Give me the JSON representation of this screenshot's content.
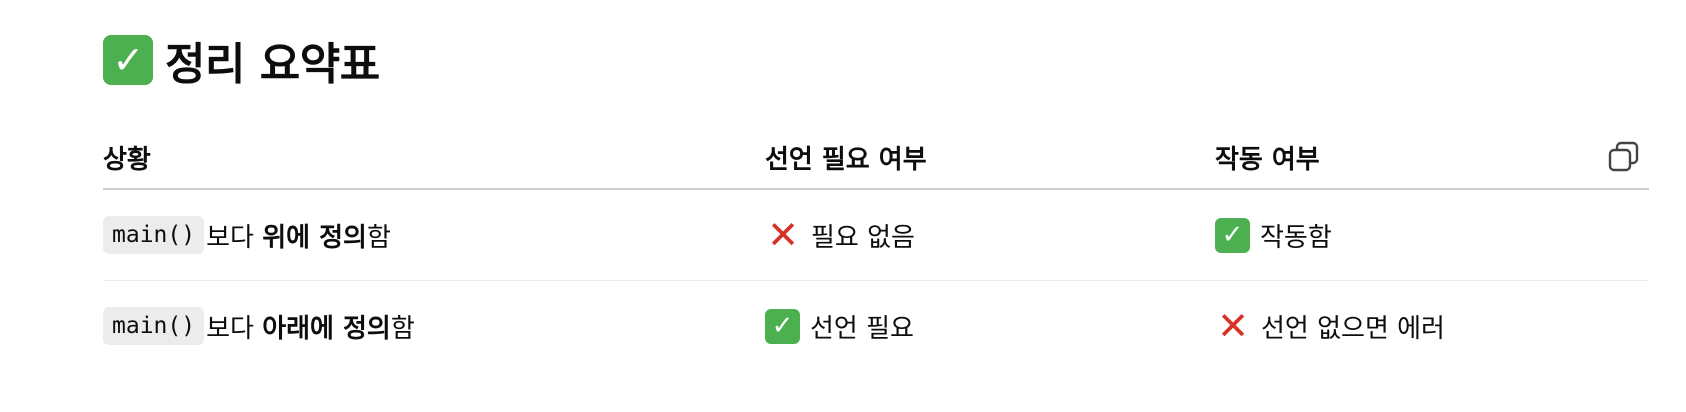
{
  "heading": {
    "icon": "check-mark-icon",
    "title": "정리 요약표"
  },
  "table": {
    "headers": [
      "상황",
      "선언 필요 여부",
      "작동 여부"
    ],
    "copy_icon": "copy-icon",
    "rows": [
      {
        "situation": {
          "code": "main()",
          "prefix": "보다 ",
          "bold": "위에 정의",
          "suffix": "함"
        },
        "declaration": {
          "icon": "cross-icon",
          "text": "필요 없음"
        },
        "works": {
          "icon": "check-mark-icon",
          "text": "작동함"
        }
      },
      {
        "situation": {
          "code": "main()",
          "prefix": "보다 ",
          "bold": "아래에 정의",
          "suffix": "함"
        },
        "declaration": {
          "icon": "check-mark-icon",
          "text": "선언 필요"
        },
        "works": {
          "icon": "cross-icon",
          "text": "선언 없으면 에러"
        }
      }
    ]
  },
  "colors": {
    "check_green": "#4caf50",
    "cross_red": "#d93025",
    "code_bg": "#ececec",
    "header_rule": "#d0d0d0"
  }
}
